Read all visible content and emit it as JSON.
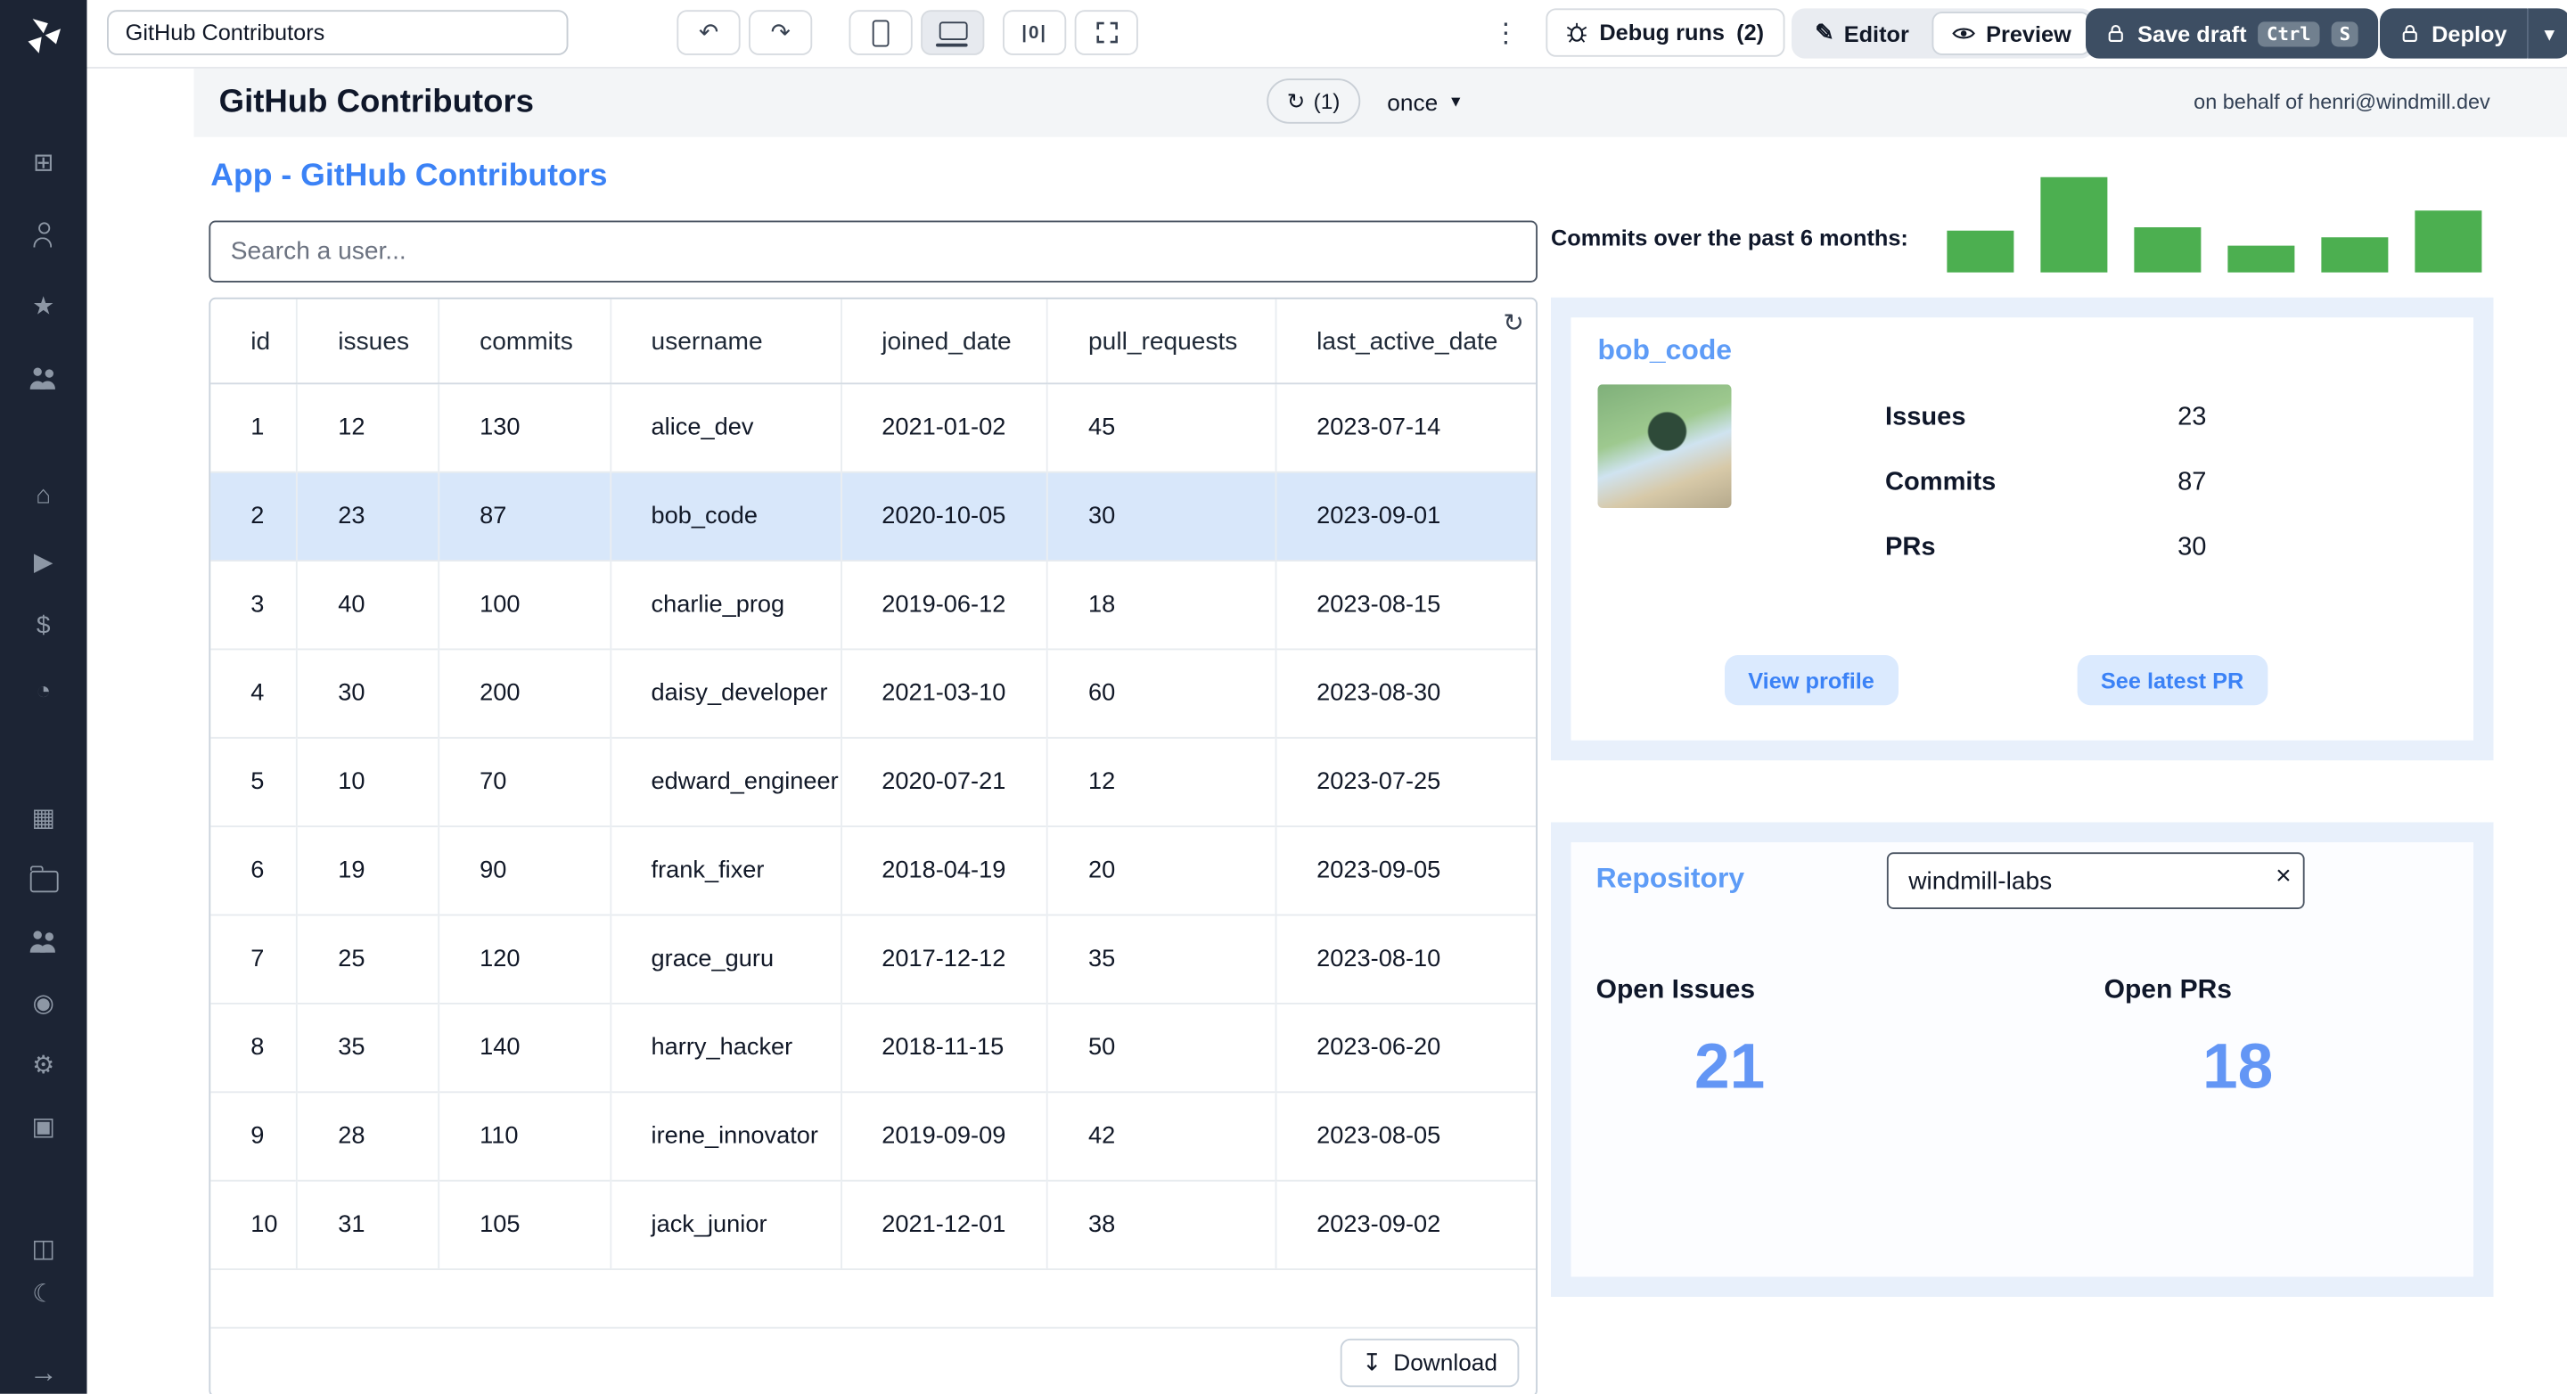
{
  "icons": {
    "undo": "↶",
    "redo": "↷",
    "kebab": "⋮",
    "pencil": "✎",
    "chevron_down": "▾",
    "refresh": "↻",
    "download": "↧",
    "close": "×",
    "grid_align": "|0|"
  },
  "toolbar": {
    "app_title": "GitHub Contributors",
    "debug_runs": {
      "label": "Debug runs",
      "count": "(2)"
    },
    "editor_label": "Editor",
    "preview_label": "Preview",
    "save_draft": {
      "label": "Save draft",
      "kbd": [
        "Ctrl",
        "S"
      ]
    },
    "deploy_label": "Deploy"
  },
  "header": {
    "title": "GitHub Contributors",
    "refresh_count": "(1)",
    "schedule": "once",
    "on_behalf": "on behalf of henri@windmill.dev"
  },
  "app": {
    "title": "App - GitHub Contributors",
    "search_placeholder": "Search a user...",
    "chart_label": "Commits over the past 6 months:",
    "table": {
      "columns": [
        "id",
        "issues",
        "commits",
        "username",
        "joined_date",
        "pull_requests",
        "last_active_date"
      ],
      "rows": [
        [
          1,
          12,
          130,
          "alice_dev",
          "2021-01-02",
          45,
          "2023-07-14"
        ],
        [
          2,
          23,
          87,
          "bob_code",
          "2020-10-05",
          30,
          "2023-09-01"
        ],
        [
          3,
          40,
          100,
          "charlie_prog",
          "2019-06-12",
          18,
          "2023-08-15"
        ],
        [
          4,
          30,
          200,
          "daisy_developer",
          "2021-03-10",
          60,
          "2023-08-30"
        ],
        [
          5,
          10,
          70,
          "edward_engineer",
          "2020-07-21",
          12,
          "2023-07-25"
        ],
        [
          6,
          19,
          90,
          "frank_fixer",
          "2018-04-19",
          20,
          "2023-09-05"
        ],
        [
          7,
          25,
          120,
          "grace_guru",
          "2017-12-12",
          35,
          "2023-08-10"
        ],
        [
          8,
          35,
          140,
          "harry_hacker",
          "2018-11-15",
          50,
          "2023-06-20"
        ],
        [
          9,
          28,
          110,
          "irene_innovator",
          "2019-09-09",
          42,
          "2023-08-05"
        ],
        [
          10,
          31,
          105,
          "jack_junior",
          "2021-12-01",
          38,
          "2023-09-02"
        ]
      ],
      "selected_row_id": 2,
      "download_label": "Download"
    },
    "user_card": {
      "username": "bob_code",
      "stats": [
        {
          "label": "Issues",
          "value": "23"
        },
        {
          "label": "Commits",
          "value": "87"
        },
        {
          "label": "PRs",
          "value": "30"
        }
      ],
      "buttons": [
        "View profile",
        "See latest PR"
      ]
    },
    "repository": {
      "title": "Repository",
      "input_value": "windmill-labs",
      "columns": [
        {
          "label": "Open Issues",
          "value": "21"
        },
        {
          "label": "Open PRs",
          "value": "18"
        }
      ]
    }
  },
  "chart_data": {
    "type": "bar",
    "title": "Commits over the past 6 months:",
    "values": [
      25,
      57,
      27,
      16,
      21,
      37
    ],
    "categories": [
      "",
      "",
      "",
      "",
      "",
      ""
    ],
    "color": "#4caf50",
    "xlabel": "",
    "ylabel": ""
  },
  "sidebar": {
    "groups": [
      {
        "items": [
          {
            "name": "calculator-icon",
            "glyph": "⊞"
          },
          {
            "name": "user-icon",
            "type": "person"
          },
          {
            "name": "star-icon",
            "glyph": "★"
          },
          {
            "name": "users-icon",
            "type": "users"
          }
        ]
      },
      {
        "items": [
          {
            "name": "home-icon",
            "glyph": "⌂"
          },
          {
            "name": "play-icon",
            "glyph": "▶"
          },
          {
            "name": "dollar-icon",
            "glyph": "$"
          },
          {
            "name": "pie-chart-icon",
            "glyph": "◔"
          }
        ]
      },
      {
        "items": [
          {
            "name": "calendar-icon",
            "glyph": "▦"
          },
          {
            "name": "folder-icon",
            "type": "folder"
          },
          {
            "name": "team-icon",
            "type": "users"
          },
          {
            "name": "eye-icon",
            "glyph": "◉"
          },
          {
            "name": "gear-icon",
            "glyph": "⚙"
          },
          {
            "name": "robot-icon",
            "glyph": "▣"
          }
        ]
      },
      {
        "items": [
          {
            "name": "docs-icon",
            "glyph": "◫"
          },
          {
            "name": "dark-mode-icon",
            "glyph": "☾"
          }
        ]
      },
      {
        "items": [
          {
            "name": "collapse-sidebar-icon",
            "glyph": "→"
          }
        ]
      }
    ]
  }
}
